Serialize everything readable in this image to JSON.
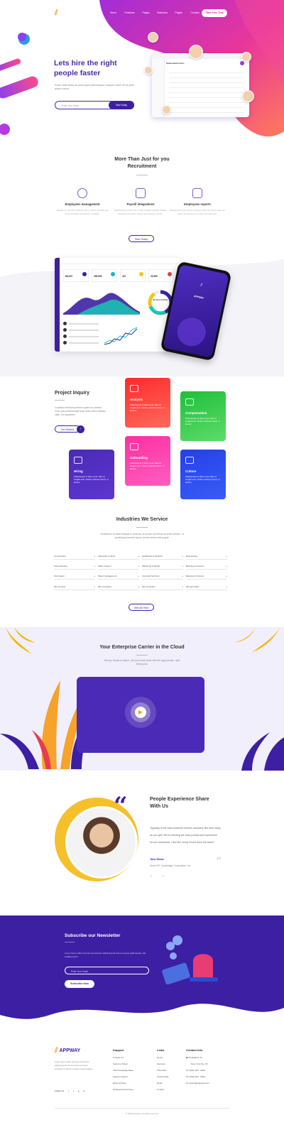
{
  "brand": {
    "name": "APPWAY"
  },
  "nav": {
    "items": [
      "Home",
      "Features",
      "Pages",
      "Solutions",
      "Pages",
      "Contact"
    ],
    "cta": "Start Free Trial"
  },
  "hero": {
    "title_line1": "Lets hire the right",
    "title_line2": "people faster",
    "subtitle": "Donec vitae lectus sit amet quam pellentesque volutpat ornare vel sit amet auctor rutrum.",
    "input_placeholder": "Enter Your Email",
    "button": "Start Today",
    "mock_title": "Subscribed Users"
  },
  "recruit": {
    "title_line1": "More Than Just for you",
    "title_line2": "Recruitment",
    "features": [
      {
        "title": "Employees management",
        "desc": "Aliquam id velit felis eleifend velit in, lacus convallis nisl vitae sed tellus vestibulum a sodales."
      },
      {
        "title": "Payroll integrations",
        "desc": "Pellentesque id leo ante in felis fringilla volutpat. Nullam vehicula velit nisl ut augue sed posuere id enim."
      },
      {
        "title": "Employees reports",
        "desc": "Maecenas id velit nisl eu tristique etiam dui, lacus vitae vel tellus dui posuere nec vitae sed odio sem."
      }
    ],
    "button": "Start Today"
  },
  "dashboard": {
    "stats": [
      "88,203",
      "405,600",
      "447",
      "23,980"
    ],
    "donut_label": "2k Gross Incomes",
    "phone_title": "APPWAY"
  },
  "inquiry": {
    "title": "Project Inquiry",
    "desc": "Curabitur tincidunt pretium quam eu pretium. Cras quis pellentesque ante dolor lorem facilisis vitae, vel dignissim.",
    "button": "Get Started",
    "cards": [
      {
        "title": "Analysis",
        "desc": "Pellentesque in feliis et est. Nam et fringilla ante. Nullam vehicula rutrum, in laoreet."
      },
      {
        "title": "Compensation",
        "desc": "Pellentesque in feliis et est. Nam et fringilla ante. Nullam vehicula rutrum, in laoreet."
      },
      {
        "title": "Onboarding",
        "desc": "Pellentesque in feliis et est. Nam et fringilla ante. Nullam vehicula rutrum, in laoreet."
      },
      {
        "title": "Hiring",
        "desc": "Pellentesque in feliis et est. Nam et fringilla ante. Nullam vehicula rutrum, in laoreet."
      },
      {
        "title": "Culture",
        "desc": "Pellentesque in feliis et est. Nam et fringilla ante. Nullam vehicula rutrum, in laoreet."
      }
    ]
  },
  "industries": {
    "title": "Industries We Service",
    "desc": "Vestibulum id vitae tristique ut pulvinar, at ornare dui lectus sit amet ultrices. Id scelerisque laoreet ipsum viverra lectus sed augue.",
    "items": [
      "Construction",
      "Industrial Conduct",
      "Healthcare & Medical",
      "Engineering",
      "Telemarketing",
      "Office support",
      "Marketing & Media",
      "Banking & Finance",
      "Information",
      "Talent management",
      "Financial Services",
      "Banking & Finance",
      "HR services",
      "HR consultant",
      "HR consultant",
      "HR generalist"
    ],
    "button": "View All Here"
  },
  "cloud": {
    "title": "Your Enterprise Carrier in the Cloud",
    "desc": "Whoop, fleeps of ipsum. Get your work done with the right people, right hiring pool."
  },
  "testimonial": {
    "title_line1": "People Experience Share",
    "title_line2": "With Us",
    "quote": "\"Appway is the best customer service company. But how many do you get? We're meeting the best product and experience for our customers. I feel like using Circuit does the same.\"",
    "author": "Tara Shaw",
    "role": "Head HR, Cambridge Corporation Ltd"
  },
  "newsletter": {
    "title": "Subscribe our Newsletter",
    "desc": "Lorem ipsum dolor sit amet consectetur adipiscing elit donec tempus pellentesque nisl sodales lorem.",
    "input_placeholder": "Enter Your Email",
    "button": "Subscribe Now"
  },
  "footer": {
    "about": "Lorem ipsum dolor sit amet consectetur adipiscing elit sed do eiusmod tempor incididunt ut labore et dolore magna aliqua.",
    "follow": "Follow Us",
    "support_title": "Support",
    "support": [
      "Contact Us",
      "Submit a Ticket",
      "Visit Knowledge Base",
      "Support System",
      "Refund Policy",
      "Professional Services"
    ],
    "links_title": "Links",
    "links": [
      "Home",
      "Services",
      "Price Plan",
      "Testimonials",
      "News",
      "Contact"
    ],
    "contact_title": "Contact Info",
    "contact": [
      "25 Madison St.",
      "New York City, NY",
      "(1234) 567 - 8910",
      "(1234) 567 - 8910",
      "contact@appway.com"
    ],
    "copyright": "© 2019 Appway. All rights reserved"
  }
}
